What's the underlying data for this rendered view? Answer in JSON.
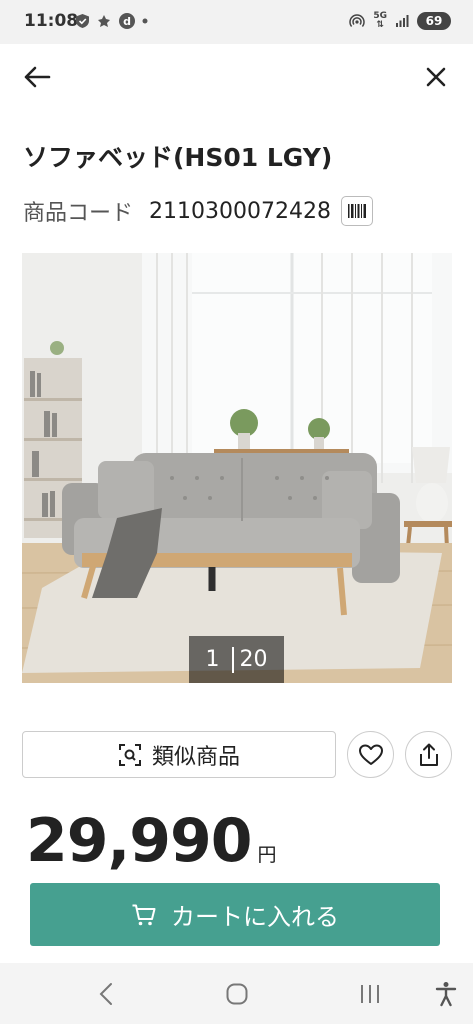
{
  "status_bar": {
    "time": "11:08",
    "network": "5G",
    "battery": "69",
    "icons": [
      "shield-icon",
      "notification-icon",
      "d-app-icon",
      "dot-icon",
      "hotspot-icon",
      "network-icon",
      "signal-icon",
      "battery-icon"
    ]
  },
  "header": {
    "back_icon": "arrow-left-icon",
    "close_icon": "close-icon"
  },
  "product": {
    "title": "ソファベッド(HS01 LGY)",
    "code_label": "商品コード",
    "code_value": "2110300072428",
    "barcode_icon": "barcode-icon"
  },
  "gallery": {
    "current": "1",
    "total": "20"
  },
  "actions": {
    "similar_label": "類似商品",
    "similar_icon": "image-search-icon",
    "favorite_icon": "heart-icon",
    "share_icon": "share-icon"
  },
  "price": {
    "value": "29,990",
    "unit": "円"
  },
  "cart": {
    "label": "カートに入れる",
    "icon": "cart-icon"
  },
  "nav_bar": {
    "icons": [
      "nav-back-icon",
      "nav-home-icon",
      "nav-recents-icon",
      "accessibility-icon"
    ]
  },
  "colors": {
    "accent": "#46a090",
    "status_bar_bg": "#f2f2f2",
    "nav_bar_bg": "#f4f4f4"
  }
}
